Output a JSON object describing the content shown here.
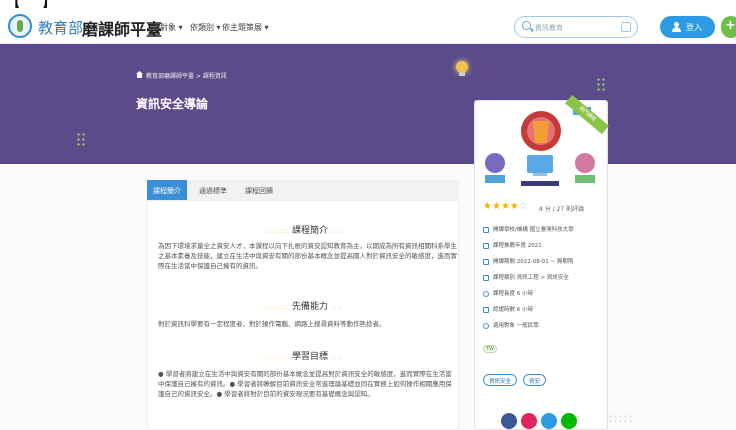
{
  "top_strip": "【 】",
  "header": {
    "brand_ministry": "教育部",
    "brand_name": "磨課師平臺",
    "nav": [
      "依對象 ▾",
      "依類別 ▾",
      "依主題策展 ▾"
    ],
    "search_placeholder": "資訊教育",
    "login_label": "登入"
  },
  "hero": {
    "breadcrumb": "教育部磨課師平臺 > 課程資訊",
    "page_title": "資訊安全導論"
  },
  "tabs": [
    "課程簡介",
    "通過標準",
    "課程回饋"
  ],
  "active_tab": 0,
  "sections": [
    {
      "title": "課程簡介",
      "body": "為因下環境求量全之資安人才，本課程以向下扎根的資安認知教育為主，以期成為所有資訊相關科系學生之基本素養及技能，建立在生活中與資安有關的部份基本概念並提高國人對於資訊安全的敏感度，進而實際在生活當中保護自己擁有的資訊。"
    },
    {
      "title": "先備能力",
      "body": "對於資訊科學要有一定程度者，對於操作電腦、網路上搜尋資料等動作熟捻者。"
    },
    {
      "title": "學習目標",
      "body": "● 學習者將建立在生活中與資安有關的部份基本概念並提高對於資訊安全的敏感度，進而實際在生活當中保護自己擁有的資訊。● 學習者將瞭解目前資訊安全常進理論基礎並同在實務上如何操作相關應用保護自己的資訊安全。● 學習者將對於目前的資安現況要有基礎概念與認知。"
    }
  ],
  "card": {
    "ribbon": "熱門課程",
    "rating_text": "4 分 / 27 則評論",
    "stars_filled": 4,
    "stars_total": 5,
    "meta": [
      "開課學校/機構  國立臺灣科技大學",
      "課程推薦年度  2021",
      "開課期間  2022-08-01 ~ 無期限",
      "課程類別  資訊工程 > 資訊安全",
      "課程長度  6 小時",
      "認證時數  6 小時",
      "適用對象  一般民眾"
    ],
    "tag": "TW",
    "pills": [
      "資訊安全",
      "資安"
    ]
  },
  "colors": {
    "hero": "#5b4b8a",
    "accent": "#3b8fd6",
    "star": "#f4b400"
  }
}
